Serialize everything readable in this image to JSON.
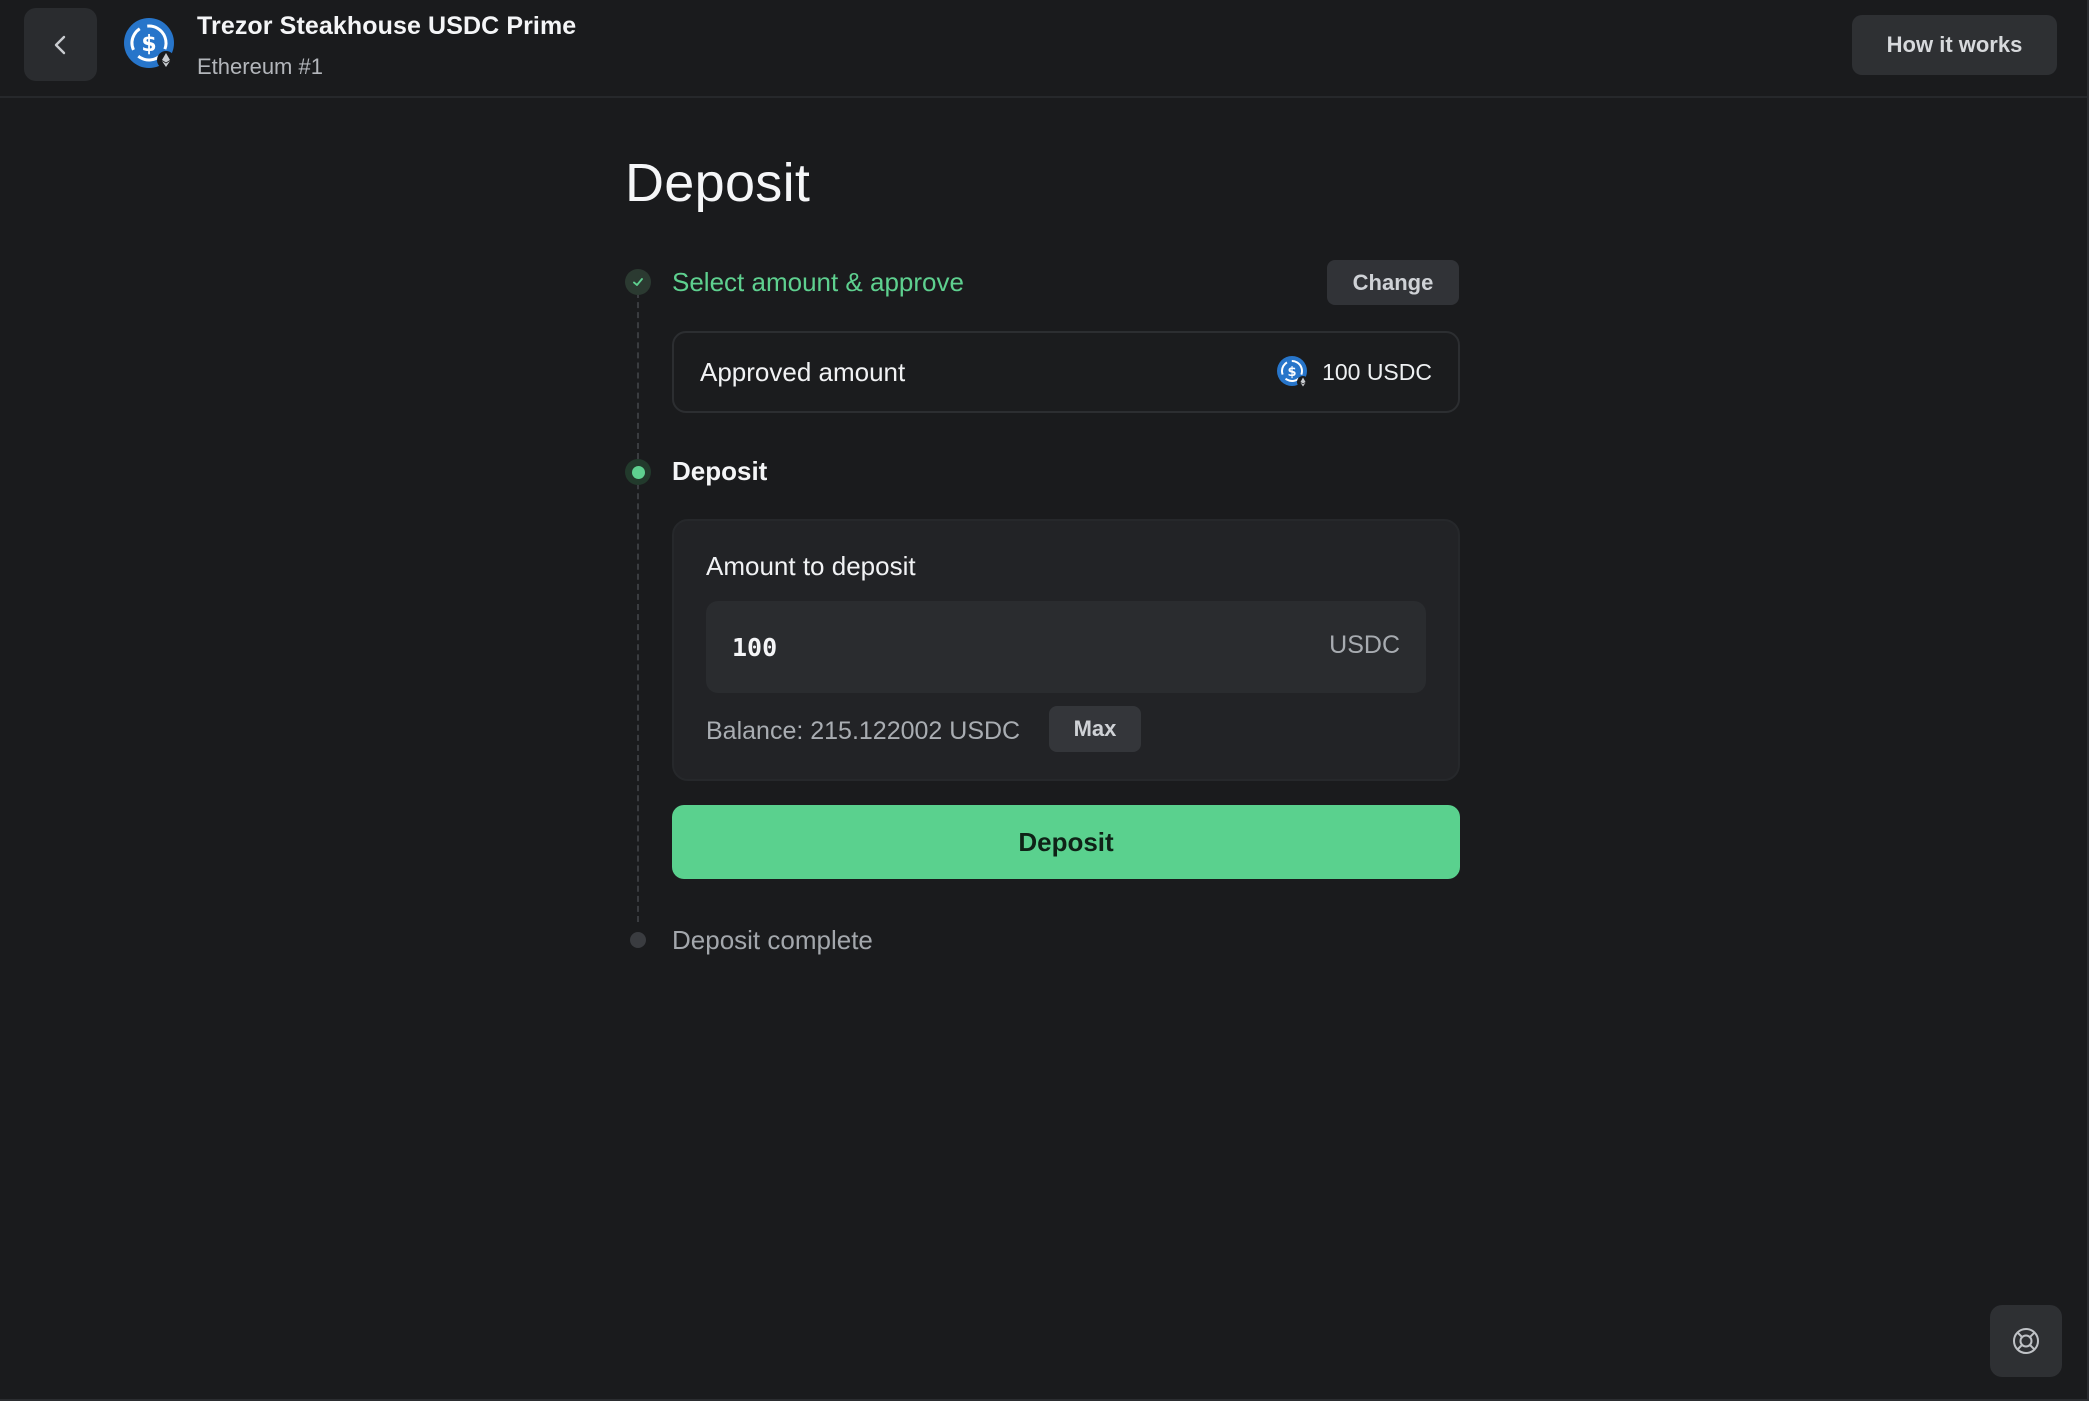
{
  "header": {
    "vault_name": "Trezor Steakhouse USDC Prime",
    "account": "Ethereum #1",
    "how_it_works": "How it works",
    "back_icon": "chevron-left-icon",
    "logo_icon": "usdc-coin-icon"
  },
  "page": {
    "title": "Deposit"
  },
  "steps": {
    "step1": {
      "label": "Select amount & approve",
      "status": "completed",
      "change_label": "Change",
      "approved_label": "Approved amount",
      "approved_value": "100 USDC"
    },
    "step2": {
      "label": "Deposit",
      "status": "active",
      "amount_label": "Amount to deposit",
      "amount_value": "100",
      "amount_unit": "USDC",
      "balance_text": "Balance: 215.122002 USDC",
      "max_label": "Max",
      "deposit_button": "Deposit"
    },
    "step3": {
      "label": "Deposit complete",
      "status": "pending"
    }
  },
  "colors": {
    "accent_green": "#5ad18e",
    "background": "#1a1b1d",
    "usdc_blue": "#2775ca"
  },
  "help_icon": "lifebuoy-icon"
}
